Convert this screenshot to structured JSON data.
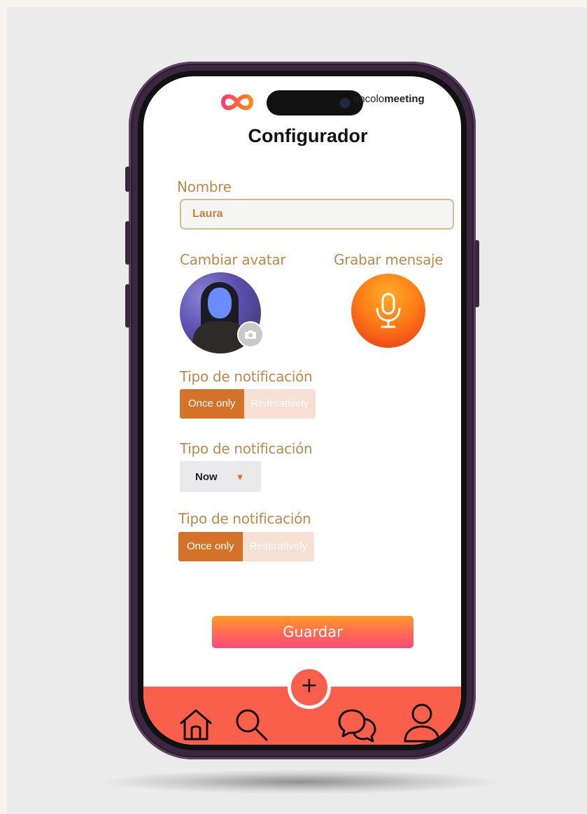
{
  "header": {
    "brand_prefix": "oncolo",
    "brand_suffix": "meeting",
    "title": "Configurador"
  },
  "form": {
    "name_label": "Nombre",
    "name_value": "Laura",
    "avatar_label": "Cambiar avatar",
    "record_label": "Grabar mensaje",
    "notification_1": {
      "label": "Tipo de notificación",
      "options": [
        "Once only",
        "Reiteratively"
      ],
      "selected": "Once only"
    },
    "notification_2": {
      "label": "Tipo de notificación",
      "selected": "Now"
    },
    "notification_3": {
      "label": "Tipo de notificación",
      "options": [
        "Once only",
        "Reiteratively"
      ],
      "selected": "Once only"
    },
    "save_label": "Guardar"
  },
  "bottom_nav": {
    "fab_label": "+",
    "items": [
      "home-icon",
      "search-icon",
      "chat-icon",
      "profile-icon"
    ]
  },
  "colors": {
    "accent_orange": "#d4722a",
    "label_gold": "#b98a4e",
    "nav_red": "#fa5f4b"
  }
}
